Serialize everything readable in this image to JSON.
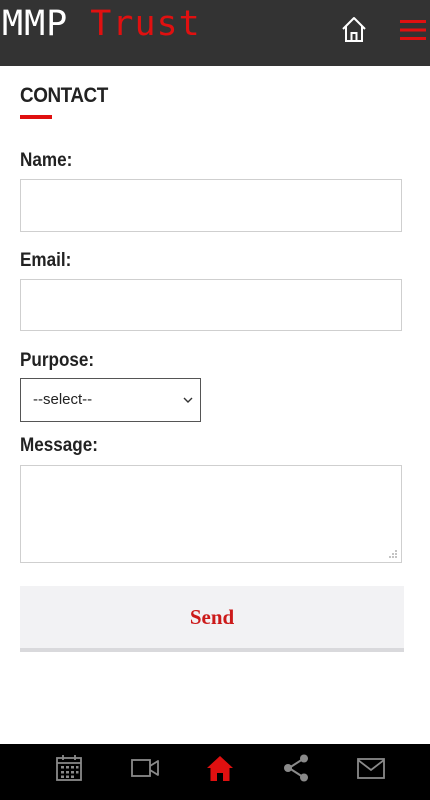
{
  "header": {
    "brand_primary": "MMP",
    "brand_accent": "Trust",
    "brand_color": "#e01010",
    "home_icon": "home-outline-icon",
    "menu_icon": "hamburger-menu-icon"
  },
  "page": {
    "title": "CONTACT"
  },
  "form": {
    "name_label": "Name:",
    "name_value": "",
    "email_label": "Email:",
    "email_value": "",
    "purpose_label": "Purpose:",
    "purpose_selected": "--select--",
    "message_label": "Message:",
    "message_value": "",
    "send_label": "Send"
  },
  "bottom_nav": [
    {
      "icon": "calendar-icon",
      "active": false
    },
    {
      "icon": "video-camera-icon",
      "active": false
    },
    {
      "icon": "home-icon",
      "active": true
    },
    {
      "icon": "share-icon",
      "active": false
    },
    {
      "icon": "mail-icon",
      "active": false
    }
  ],
  "colors": {
    "accent": "#e01010",
    "topbar": "#333333",
    "bottombar": "#000000",
    "nav_icon": "#8a8a8a"
  }
}
